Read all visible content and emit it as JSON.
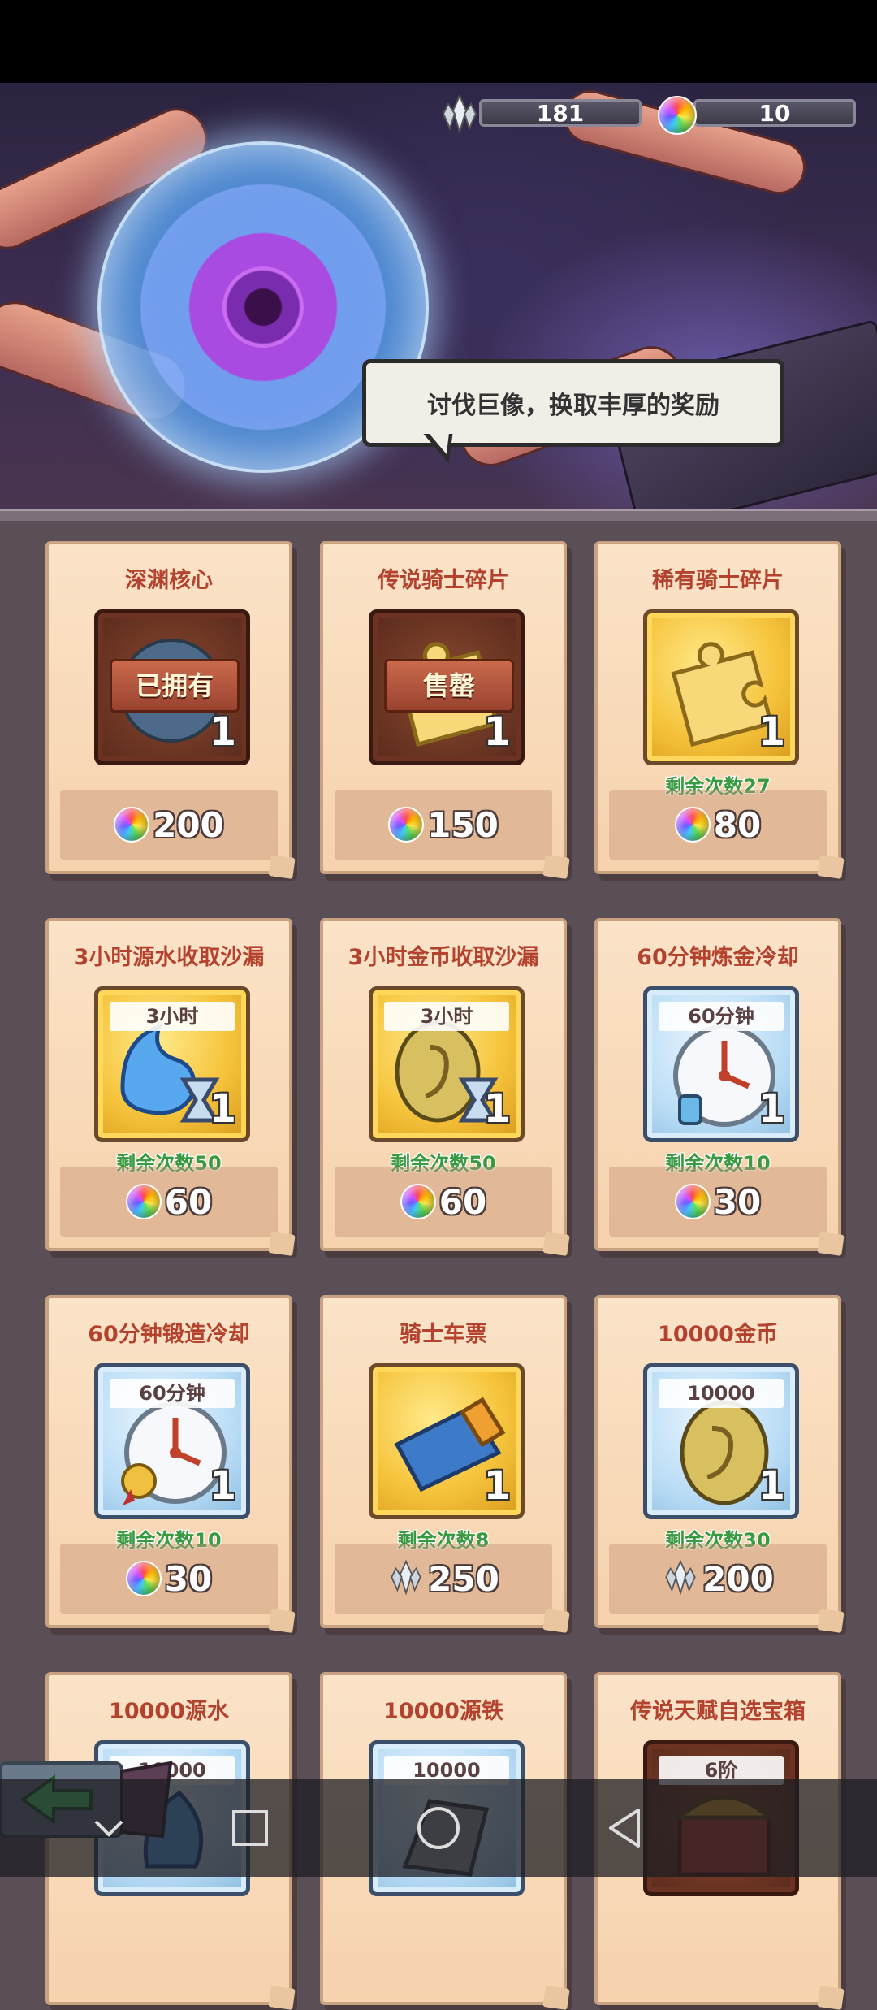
{
  "currency": {
    "crystal": {
      "icon": "crystal-icon",
      "value": "181"
    },
    "gem": {
      "icon": "rainbow-gem-icon",
      "value": "10"
    }
  },
  "banner": {
    "speech": "讨伐巨像，换取丰厚的奖励"
  },
  "shop_items": [
    {
      "title": "深渊核心",
      "status": "已拥有",
      "count": "1",
      "remaining": "",
      "price": "200",
      "currency": "gem",
      "frame": "dark",
      "icon": "abyss-core-icon"
    },
    {
      "title": "传说骑士碎片",
      "status": "售罄",
      "count": "1",
      "remaining": "",
      "price": "150",
      "currency": "gem",
      "frame": "dark",
      "icon": "puzzle-piece-icon"
    },
    {
      "title": "稀有骑士碎片",
      "status": "",
      "count": "1",
      "remaining": "剩余次数27",
      "price": "80",
      "currency": "gem",
      "frame": "gold",
      "icon": "puzzle-piece-icon"
    },
    {
      "title": "3小时源水收取沙漏",
      "label": "3小时",
      "count": "1",
      "remaining": "剩余次数50",
      "price": "60",
      "currency": "gem",
      "frame": "gold",
      "icon": "water-hourglass-icon"
    },
    {
      "title": "3小时金币收取沙漏",
      "label": "3小时",
      "count": "1",
      "remaining": "剩余次数50",
      "price": "60",
      "currency": "gem",
      "frame": "gold",
      "icon": "coin-hourglass-icon"
    },
    {
      "title": "60分钟炼金冷却",
      "label": "60分钟",
      "count": "1",
      "remaining": "剩余次数10",
      "price": "30",
      "currency": "gem",
      "frame": "blue",
      "icon": "alchemy-clock-icon"
    },
    {
      "title": "60分钟锻造冷却",
      "label": "60分钟",
      "count": "1",
      "remaining": "剩余次数10",
      "price": "30",
      "currency": "gem",
      "frame": "blue",
      "icon": "forge-clock-icon"
    },
    {
      "title": "骑士车票",
      "label": "",
      "count": "1",
      "remaining": "剩余次数8",
      "price": "250",
      "currency": "crystal",
      "frame": "gold",
      "icon": "ticket-icon"
    },
    {
      "title": "10000金币",
      "label": "10000",
      "count": "1",
      "remaining": "剩余次数30",
      "price": "200",
      "currency": "crystal",
      "frame": "blue",
      "icon": "gold-coin-icon"
    },
    {
      "title": "10000源水",
      "label": "10000",
      "frame": "blue",
      "icon": "water-icon"
    },
    {
      "title": "10000源铁",
      "label": "10000",
      "frame": "blue",
      "icon": "iron-icon"
    },
    {
      "title": "传说天赋自选宝箱",
      "label": "6阶",
      "frame": "dark",
      "icon": "treasure-chest-icon"
    }
  ],
  "colors": {
    "title": "#b3432e",
    "remaining": "#3a9a42",
    "gold_frame": "#f6c43c",
    "blue_frame": "#b9dcf5"
  }
}
